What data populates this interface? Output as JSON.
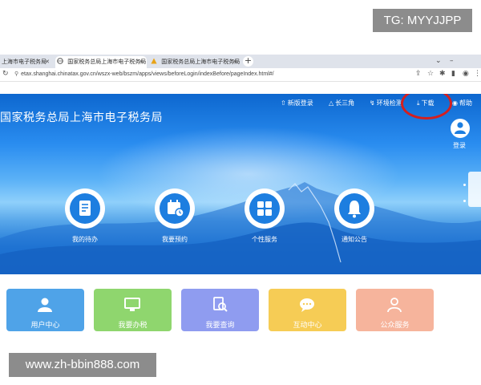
{
  "watermarks": {
    "top": "TG: MYYJJPP",
    "bottom": "www.zh-bbin888.com"
  },
  "browser": {
    "tabs": [
      {
        "label": "上海市电子税务局",
        "favicon": "page-icon"
      },
      {
        "label": "国家税务总局上海市电子税务局",
        "favicon": "globe-icon"
      },
      {
        "label": "国家税务总局上海市电子税务局",
        "favicon": "warning-icon"
      }
    ],
    "new_tab_glyph": "+",
    "url": "etax.shanghai.chinatax.gov.cn/wszx-web/bszm/apps/views/beforeLogin/indexBefore/pageIndex.html#/"
  },
  "site": {
    "title": "国家税务总局上海市电子税务局",
    "topnav": [
      {
        "icon": "home-up-icon",
        "label": "新版登录"
      },
      {
        "icon": "triangle-icon",
        "label": "长三角"
      },
      {
        "icon": "wrench-icon",
        "label": "环境检测"
      },
      {
        "icon": "download-icon",
        "label": "下载"
      },
      {
        "icon": "help-icon",
        "label": "帮助"
      }
    ],
    "login_label": "登录",
    "highlight_color": "#d41f1f"
  },
  "services": [
    {
      "label": "我的待办",
      "icon": "todo-document-icon"
    },
    {
      "label": "我要预约",
      "icon": "calendar-clock-icon"
    },
    {
      "label": "个性服务",
      "icon": "grid-icon"
    },
    {
      "label": "通知公告",
      "icon": "bell-icon"
    }
  ],
  "cards": [
    {
      "label": "用户中心",
      "icon": "user-icon",
      "color": "#4fa3e8"
    },
    {
      "label": "我要办税",
      "icon": "monitor-icon",
      "color": "#8fd66e"
    },
    {
      "label": "我要查询",
      "icon": "search-doc-icon",
      "color": "#8f9cf0"
    },
    {
      "label": "互动中心",
      "icon": "chat-icon",
      "color": "#f6cc55"
    },
    {
      "label": "公众服务",
      "icon": "people-icon",
      "color": "#f6b49c"
    }
  ]
}
